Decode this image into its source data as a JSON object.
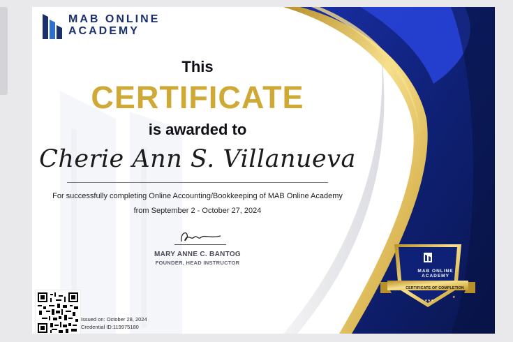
{
  "colors": {
    "navy": "#0d1b5e",
    "royal_blue": "#1f3bc1",
    "gold": "#d4af37",
    "gold_light": "#f5df8a",
    "text_dark": "#0e0e14"
  },
  "logo": {
    "line1": "MAB ONLINE",
    "line2": "ACADEMY",
    "icon": "mab-building-logo-icon"
  },
  "certificate": {
    "this": "This",
    "title": "CERTIFICATE",
    "awarded": "is awarded to",
    "recipient": "Cherie Ann S. Villanueva",
    "description": "For successfully completing Online Accounting/Bookkeeping of MAB Online Academy",
    "dates": "from September 2 - October 27, 2024"
  },
  "signatory": {
    "name": "MARY ANNE C. BANTOG",
    "role": "FOUNDER, HEAD INSTRUCTOR",
    "signature_icon": "signature-icon"
  },
  "footer": {
    "issued": "Issued on: October 28, 2024",
    "credential": "Credential ID:119975180",
    "qr_icon": "qr-code-icon"
  },
  "badge": {
    "line1": "MAB ONLINE",
    "line2": "ACADEMY",
    "ribbon": "CERTIFICATE OF COMPLETION",
    "icon": "completion-badge-icon"
  }
}
